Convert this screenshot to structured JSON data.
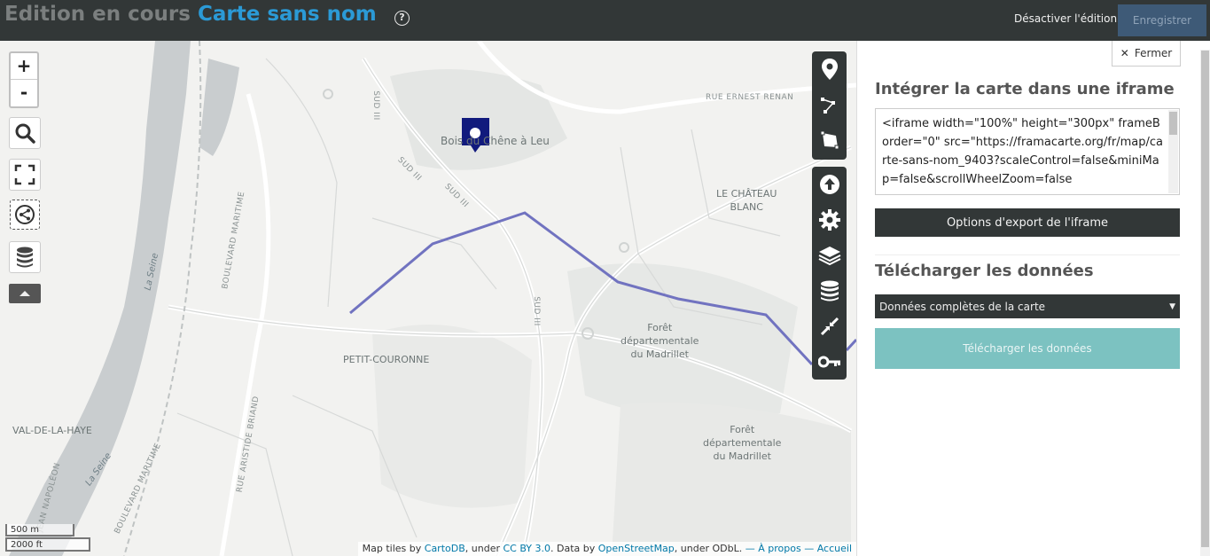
{
  "header": {
    "prefix": "Edition en cours",
    "map_name": "Carte sans nom",
    "help_label": "?",
    "disable_edit_label": "Désactiver l'édition",
    "save_label": "Enregistrer"
  },
  "map": {
    "labels": {
      "bois": "Bois du Chêne à Leu",
      "chateau": "LE CHÂTEAU\nBLANC",
      "petit_couronne": "PETIT-COURONNE",
      "val_haye": "VAL-DE-LA-HAYE",
      "foret1": "Forêt\ndépartementale\ndu Madrillet",
      "foret2": "Forêt\ndépartementale\ndu Madrillet",
      "rue_renan": "RUE ERNEST RENAN",
      "sud3_a": "SUD III",
      "sud3_b": "SUD III",
      "sud3_c": "SUD III",
      "sud3_d": "SUD III",
      "bd_maritime": "BOULEVARD MARITIME",
      "bd_maritime2": "BOULEVARD MARITIME",
      "rue_briand": "RUE ARISTIDE BRIAND",
      "napoleon": "JEAN NAPOLÉON",
      "seine1": "La Seine",
      "seine2": "La Seine"
    },
    "zoom_in": "+",
    "zoom_out": "-",
    "scale_metric": "500 m",
    "scale_imperial": "2000 ft",
    "attribution": {
      "p1": "Map tiles by ",
      "cartodb": "CartoDB",
      "p2": ", under ",
      "ccby": "CC BY 3.0",
      "p3": ". Data by ",
      "osm": "OpenStreetMap",
      "p4": ", under ODbL. ",
      "apropos": "— À propos",
      "accueil": "— Accueil"
    }
  },
  "panel": {
    "close_label": "Fermer",
    "embed_title": "Intégrer la carte dans une iframe",
    "iframe_code": "<iframe width=\"100%\" height=\"300px\" frameBorder=\"0\" src=\"https://framacarte.org/fr/map/carte-sans-nom_9403?scaleControl=false&miniMap=false&scrollWheelZoom=false",
    "export_options_label": "Options d'export de l'iframe",
    "download_title": "Télécharger les données",
    "select_value": "Données complètes de la carte",
    "download_button": "Télécharger les données"
  },
  "colors": {
    "header_bg": "#323737",
    "accent": "#2b9ad6",
    "route": "#7173c0",
    "marker": "#111a7d",
    "download_btn": "#7cc2c1"
  }
}
